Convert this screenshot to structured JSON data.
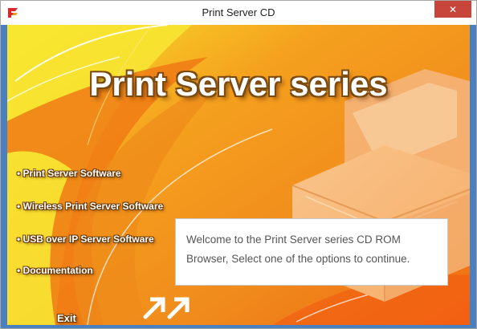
{
  "window": {
    "title": "Print Server CD",
    "close_symbol": "✕"
  },
  "banner": {
    "text": "Print Server series"
  },
  "menu": [
    {
      "label": "• Print Server Software"
    },
    {
      "label": "• Wireless Print Server Software"
    },
    {
      "label": "• USB over IP Server Software"
    },
    {
      "label": "• Documentation"
    }
  ],
  "exit": {
    "label": "Exit"
  },
  "info": {
    "line1": "Welcome to the Print Server series CD ROM",
    "line2": "Browser, Select one of the options to continue."
  },
  "colors": {
    "accent_orange": "#f08a1c",
    "yellow": "#f7e42a",
    "close_red": "#c7453b"
  },
  "icons": {
    "app": "app-logo-icon",
    "close": "close-icon",
    "arrows": "double-arrow-icon"
  }
}
